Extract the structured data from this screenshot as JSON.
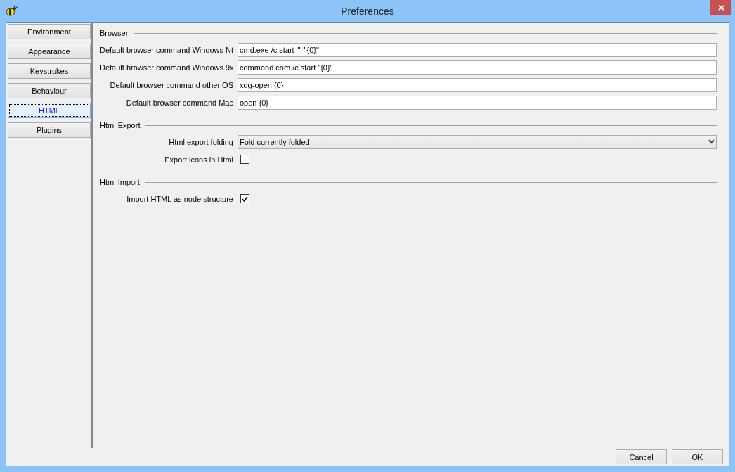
{
  "window": {
    "title": "Preferences"
  },
  "sidebar": {
    "items": [
      {
        "label": "Environment",
        "selected": false
      },
      {
        "label": "Appearance",
        "selected": false
      },
      {
        "label": "Keystrokes",
        "selected": false
      },
      {
        "label": "Behaviour",
        "selected": false
      },
      {
        "label": "HTML",
        "selected": true
      },
      {
        "label": "Plugins",
        "selected": false
      }
    ]
  },
  "sections": [
    {
      "title": "Browser",
      "rows": [
        {
          "kind": "text",
          "label": "Default browser command Windows Nt",
          "value": "cmd.exe /c start \"\" \"{0}\""
        },
        {
          "kind": "text",
          "label": "Default browser command Windows 9x",
          "value": "command.com /c start \"{0}\""
        },
        {
          "kind": "text",
          "label": "Default browser command other OS",
          "value": "xdg-open {0}"
        },
        {
          "kind": "text",
          "label": "Default browser command Mac",
          "value": "open {0}"
        }
      ]
    },
    {
      "title": "Html Export",
      "rows": [
        {
          "kind": "select",
          "label": "Html export folding",
          "value": "Fold currently folded"
        },
        {
          "kind": "checkbox",
          "label": "Export icons in Html",
          "checked": false
        }
      ]
    },
    {
      "title": "Html Import",
      "rows": [
        {
          "kind": "checkbox",
          "label": "Import HTML as node structure",
          "checked": true
        }
      ]
    }
  ],
  "buttons": [
    "Cancel",
    "OK"
  ]
}
